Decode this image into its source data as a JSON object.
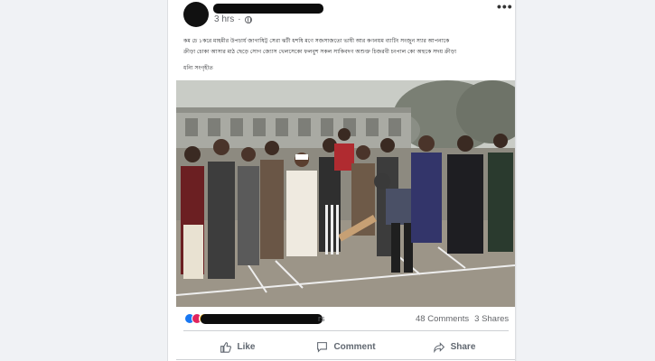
{
  "post": {
    "author_redacted": "",
    "timestamp": "3 hrs",
    "text_line1": "কম চে ১করে মাহমীর উপচার্য জাগাষিট্ট সেরা ঝটী ধশষি মণে সজসাজতো ভাষী আর কণনয়ম ব্যাটিং সংজুন স্যার আপনাকে",
    "text_line2": "ক্রীড়া চোকা আসার মাঠ ছেড়ে সোগ জ্যোস খেলসেকো ফলবুশ সকল সাকিবদণ অশুক্ত চিজরবী চংপাল কো অহুকে সদয় ক্রীড়া",
    "text_sub": "ধন্যি সংগৃহীত",
    "more_label": "•••"
  },
  "reactions": {
    "redacted_names": "",
    "suffix": "rs",
    "comments": "48 Comments",
    "shares": "3 Shares"
  },
  "actions": {
    "like": "Like",
    "comment": "Comment",
    "share": "Share"
  },
  "icons": {
    "like": "thumbs-up-icon",
    "comment": "speech-bubble-icon",
    "share": "share-arrow-icon",
    "globe": "globe-icon",
    "more": "more-dots-icon"
  },
  "colors": {
    "link_blue": "#1877f2",
    "text_secondary": "#65676b",
    "redaction": "#0d0d0d"
  }
}
